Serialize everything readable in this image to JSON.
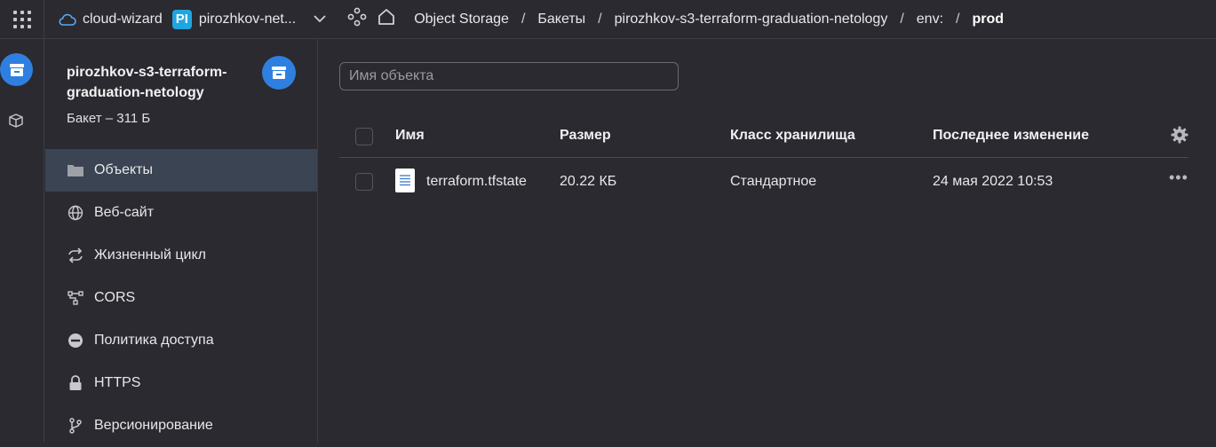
{
  "topbar": {
    "cloud_name": "cloud-wizard",
    "folder_badge": "PI",
    "folder_name": "pirozhkov-net...",
    "breadcrumbs": [
      "Object Storage",
      "Бакеты",
      "pirozhkov-s3-terraform-graduation-netology",
      "env:"
    ],
    "current": "prod"
  },
  "sidebar": {
    "bucket_title": "pirozhkov-s3-terraform-graduation-netology",
    "bucket_subtitle": "Бакет – 311 Б",
    "items": [
      {
        "label": "Объекты",
        "icon": "folder-icon",
        "active": true
      },
      {
        "label": "Веб-сайт",
        "icon": "globe-icon"
      },
      {
        "label": "Жизненный цикл",
        "icon": "cycle-icon"
      },
      {
        "label": "CORS",
        "icon": "cors-icon"
      },
      {
        "label": "Политика доступа",
        "icon": "no-entry-icon"
      },
      {
        "label": "HTTPS",
        "icon": "lock-icon"
      },
      {
        "label": "Версионирование",
        "icon": "branch-icon"
      }
    ]
  },
  "main": {
    "search_placeholder": "Имя объекта",
    "columns": {
      "name": "Имя",
      "size": "Размер",
      "storage_class": "Класс хранилища",
      "modified": "Последнее изменение"
    },
    "rows": [
      {
        "name": "terraform.tfstate",
        "size": "20.22 КБ",
        "storage_class": "Стандартное",
        "modified": "24 мая 2022 10:53"
      }
    ]
  },
  "colors": {
    "accent": "#2f7fe0",
    "badge": "#1fa6e0",
    "background": "#2a2a30",
    "active_item": "#3a4452"
  }
}
